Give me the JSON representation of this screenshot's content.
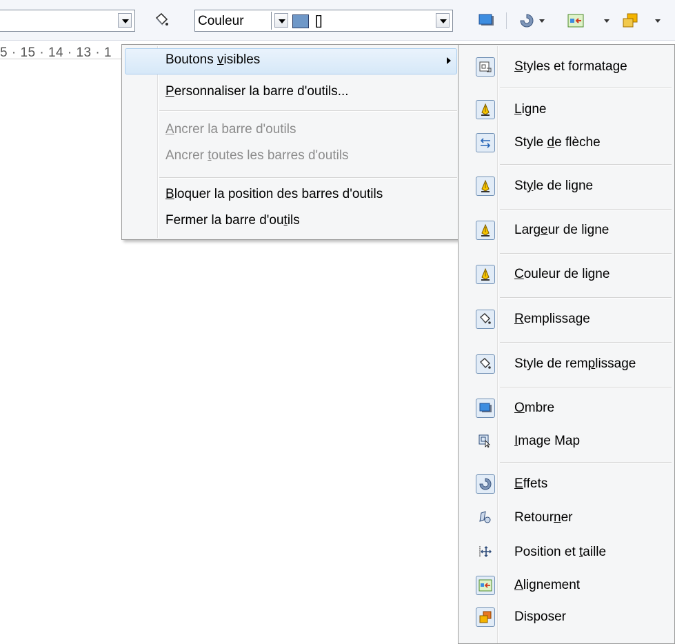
{
  "toolbar": {
    "style_value": "",
    "area_kind": "Couleur",
    "area_color": "[]",
    "area_color_swatch": "#6f98c8",
    "icons": [
      "area-fill-icon",
      "shadow-icon",
      "effects-icon",
      "alignment-icon",
      "arrange-icon"
    ]
  },
  "ruler": {
    "text": "5 · 15 · 14 · 13 · 1"
  },
  "menu": {
    "items": [
      {
        "pre": "Boutons ",
        "u": "v",
        "post": "isibles",
        "enabled": true,
        "submenu": true
      },
      {
        "pre": "",
        "u": "P",
        "post": "ersonnaliser la barre d'outils...",
        "enabled": true
      },
      {
        "pre": "",
        "u": "A",
        "post": "ncrer la barre d'outils",
        "enabled": false
      },
      {
        "pre": "Ancrer ",
        "u": "t",
        "post": "outes les barres d'outils",
        "enabled": false
      },
      {
        "pre": "",
        "u": "B",
        "post": "loquer la position des barres d'outils",
        "enabled": true
      },
      {
        "pre": "Fermer la barre d'ou",
        "u": "t",
        "post": "ils",
        "enabled": true
      }
    ]
  },
  "submenu": {
    "items": [
      {
        "pre": "",
        "u": "S",
        "post": "tyles et formatage",
        "icon": "styles-formatting-icon",
        "checked": true
      },
      {
        "pre": "",
        "u": "L",
        "post": "igne",
        "icon": "line-icon",
        "checked": true
      },
      {
        "pre": "Style ",
        "u": "d",
        "post": "e flèche",
        "icon": "arrow-style-icon",
        "checked": true
      },
      {
        "pre": "St",
        "u": "y",
        "post": "le de ligne",
        "icon": "line-style-icon",
        "checked": true
      },
      {
        "pre": "Larg",
        "u": "e",
        "post": "ur de ligne",
        "icon": "line-width-icon",
        "checked": true
      },
      {
        "pre": "",
        "u": "C",
        "post": "ouleur de ligne",
        "icon": "line-color-icon",
        "checked": true
      },
      {
        "pre": "",
        "u": "R",
        "post": "emplissage",
        "icon": "area-icon",
        "checked": true
      },
      {
        "pre": "Style de rem",
        "u": "p",
        "post": "lissage",
        "icon": "area-style-icon",
        "checked": true
      },
      {
        "pre": "",
        "u": "O",
        "post": "mbre",
        "icon": "shadow-icon",
        "checked": true
      },
      {
        "pre": "",
        "u": "I",
        "post": "mage Map",
        "icon": "image-map-icon",
        "checked": false
      },
      {
        "pre": "",
        "u": "E",
        "post": "ffets",
        "icon": "effects-icon",
        "checked": true
      },
      {
        "pre": "Retour",
        "u": "n",
        "post": "er",
        "icon": "flip-icon",
        "checked": false
      },
      {
        "pre": "Position et ",
        "u": "t",
        "post": "aille",
        "icon": "position-size-icon",
        "checked": false
      },
      {
        "pre": "",
        "u": "A",
        "post": "lignement",
        "icon": "alignment-icon",
        "checked": true
      },
      {
        "pre": "",
        "u": "",
        "post": "Disposer",
        "icon": "arrange-icon",
        "checked": true
      }
    ]
  }
}
